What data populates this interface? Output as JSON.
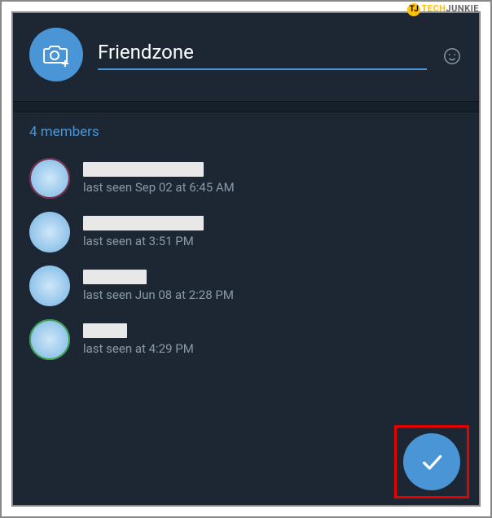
{
  "watermark": {
    "badge": "TJ",
    "part1": "TECH",
    "part2": "JUNKIE"
  },
  "header": {
    "group_name": "Friendzone"
  },
  "members": {
    "title": "4 members",
    "list": [
      {
        "status": "last seen Sep 02 at 6:45 AM"
      },
      {
        "status": "last seen at 3:51 PM"
      },
      {
        "status": "last seen Jun 08 at 2:28 PM"
      },
      {
        "status": "last seen at 4:29 PM"
      }
    ]
  }
}
